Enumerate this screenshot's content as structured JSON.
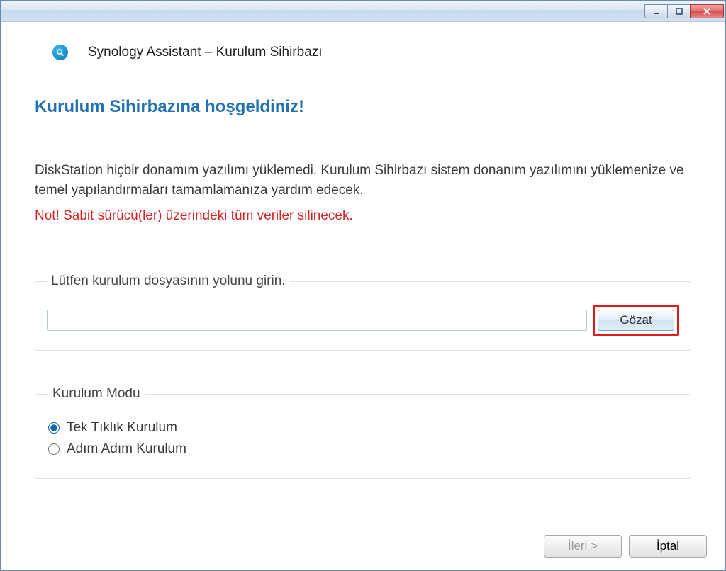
{
  "window": {
    "app_title": "Synology Assistant – Kurulum Sihirbazı"
  },
  "main": {
    "heading": "Kurulum Sihirbazına hoşgeldiniz!",
    "description": "DiskStation hiçbir donamım yazılımı yüklemedi. Kurulum Sihirbazı sistem donanım yazılımını yüklemenize ve temel yapılandırmaları tamamlamanıza yardım edecek.",
    "warning": "Not! Sabit sürücü(ler) üzerindeki tüm veriler silinecek."
  },
  "path_group": {
    "legend": "Lütfen kurulum dosyasının yolunu girin.",
    "value": "",
    "browse_label": "Gözat"
  },
  "mode_group": {
    "legend": "Kurulum Modu",
    "options": [
      {
        "label": "Tek Tıklık Kurulum",
        "selected": true
      },
      {
        "label": "Adım Adım Kurulum",
        "selected": false
      }
    ]
  },
  "footer": {
    "next_label": "İleri >",
    "cancel_label": "İptal"
  }
}
